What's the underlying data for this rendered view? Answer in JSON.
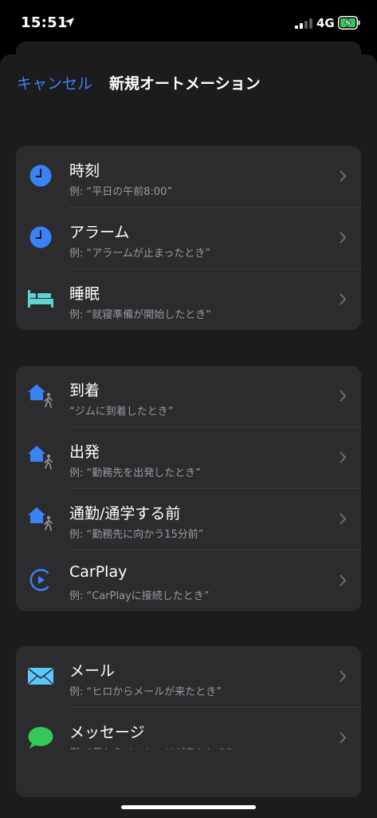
{
  "status": {
    "time": "15:51",
    "network": "4G"
  },
  "nav": {
    "cancel_label": "キャンセル",
    "title": "新規オートメーション"
  },
  "groups": [
    {
      "items": [
        {
          "title": "時刻",
          "subtitle": "例: “平日の午前8:00”",
          "icon": "clock-icon"
        },
        {
          "title": "アラーム",
          "subtitle": "例: “アラームが止まったとき”",
          "icon": "alarm-clock-icon"
        },
        {
          "title": "睡眠",
          "subtitle": "例: “就寝準備が開始したとき”",
          "icon": "bed-icon"
        }
      ]
    },
    {
      "items": [
        {
          "title": "到着",
          "subtitle": "“ジムに到着したとき”",
          "icon": "arrive-home-walk-icon"
        },
        {
          "title": "出発",
          "subtitle": "例: “勤務先を出発したとき”",
          "icon": "leave-home-walk-icon"
        },
        {
          "title": "通勤/通学する前",
          "subtitle": "例: “勤務先に向かう15分前”",
          "icon": "commute-home-walk-icon"
        },
        {
          "title": "CarPlay",
          "subtitle": "例: “CarPlayに接続したとき”",
          "icon": "carplay-icon"
        }
      ]
    },
    {
      "items": [
        {
          "title": "メール",
          "subtitle": "例: “ヒロからメールが来たとき”",
          "icon": "mail-icon"
        },
        {
          "title": "メッセージ",
          "subtitle": "例: “母からメッセージが来たとき”",
          "icon": "messages-icon"
        }
      ]
    }
  ],
  "colors": {
    "accent": "#3b82f6",
    "background": "#000000",
    "sheet": "#1c1c1e",
    "card": "#2c2c2e",
    "secondary_text": "#9a9aa0",
    "bed": "#5fd3d0",
    "mail": "#5ac8fa",
    "messages": "#34c759",
    "battery_charge": "#34c759"
  }
}
